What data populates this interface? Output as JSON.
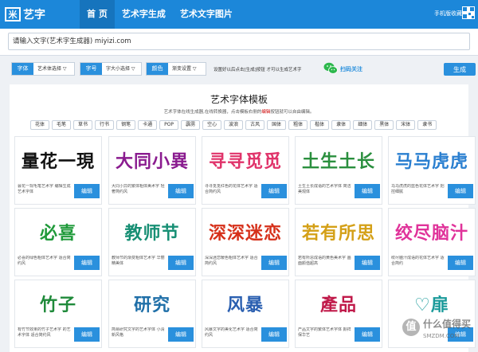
{
  "app": {
    "logo_mark": "米",
    "logo_text": "艺字"
  },
  "nav": [
    {
      "label": "首 页",
      "active": true
    },
    {
      "label": "艺术字生成"
    },
    {
      "label": "艺术文字图片"
    }
  ],
  "header": {
    "mobile_label": "手机版收藏"
  },
  "input": {
    "value": "请输入文字(艺术字生成器) miyizi.com"
  },
  "options": {
    "font": {
      "label": "字体",
      "value": "艺术体选择 ▽"
    },
    "size": {
      "label": "字号",
      "value": "字大小选择 ▽"
    },
    "color": {
      "label": "颜色",
      "value": "渐变设置 ▽"
    },
    "note": "设置好以后点击[生成]按钮  才可以生成艺术字",
    "wechat": "扫码关注",
    "generate": "生成"
  },
  "panel": {
    "title": "艺术字体模板",
    "sub_before": "艺术字体在线生成器,在线转换器，点击模板右侧的",
    "sub_highlight": "编辑",
    "sub_after": "按钮就可以自由编辑。",
    "tags": [
      "花体",
      "毛笔",
      "草书",
      "行书",
      "钢笔",
      "卡通",
      "POP",
      "霹雳",
      "空心",
      "波浪",
      "古风",
      "国体",
      "粗体",
      "楷体",
      "隶体",
      "细体",
      "黑体",
      "宋体",
      "隶书"
    ]
  },
  "cards": [
    {
      "art": "量花一現",
      "color": "#111111",
      "desc": "昙花一现毛笔艺术字 编辑生成艺术字体",
      "btn": "编辑"
    },
    {
      "art": "大同小異",
      "color": "#8a1b8f",
      "desc": "大同小异的繁体粗体美术字 轻奢简约风",
      "btn": "编辑"
    },
    {
      "art": "寻寻觅觅",
      "color": "#e0336a",
      "desc": "寻寻觅觅红色的花体艺术字 适合简约风",
      "btn": "编辑"
    },
    {
      "art": "土生土长",
      "color": "#2a8f3e",
      "desc": "土生土长成语的艺术字体 简洁美观体",
      "btn": "编辑"
    },
    {
      "art": "马马虎虎",
      "color": "#2a7fd0",
      "desc": "马马虎虎的蓝色花体艺术字 把控细腻",
      "btn": "编辑"
    },
    {
      "art": "必喜",
      "color": "#1f9a3a",
      "desc": "必喜的绿色粗体艺术字 适合简约风",
      "btn": "编辑"
    },
    {
      "art": "教师节",
      "color": "#178f74",
      "desc": "教师节的渐变粗体艺术字 华丽精美体",
      "btn": "编辑"
    },
    {
      "art": "深深迷恋",
      "color": "#d6301a",
      "desc": "深深迷恋暖色粗体艺术字 适合简约风",
      "btn": "编辑"
    },
    {
      "art": "若有所思",
      "color": "#d4a017",
      "desc": "若有所思成语的黄色美术字 画面颜值超高",
      "btn": "编辑"
    },
    {
      "art": "绞尽脑汁",
      "color": "#e0339a",
      "desc": "绞尽脑汁成语的花体艺术字 适合简约",
      "btn": "编辑"
    },
    {
      "art": "竹子",
      "color": "#1f8a3a",
      "desc": "有竹节效果的竹子艺术字 的艺术字体 适合简约风",
      "btn": "编辑"
    },
    {
      "art": "研究",
      "color": "#1f6fa8",
      "desc": "简易研究文字的艺术字体 小清新风格",
      "btn": "编辑"
    },
    {
      "art": "风暴",
      "color": "#2a5fb0",
      "desc": "风暴文字的美化艺术字 适合简约风",
      "btn": "编辑"
    },
    {
      "art": "產品",
      "color": "#c01a4a",
      "desc": "产品文字的繁体艺术字体 颜祥保华艺",
      "btn": "编辑"
    },
    {
      "art": "♡扉",
      "color": "#1a9a9a",
      "desc": "",
      "btn": "编辑"
    }
  ],
  "watermark": {
    "mark": "值",
    "text": "什么值得买",
    "url": "SMZDM.COM"
  }
}
